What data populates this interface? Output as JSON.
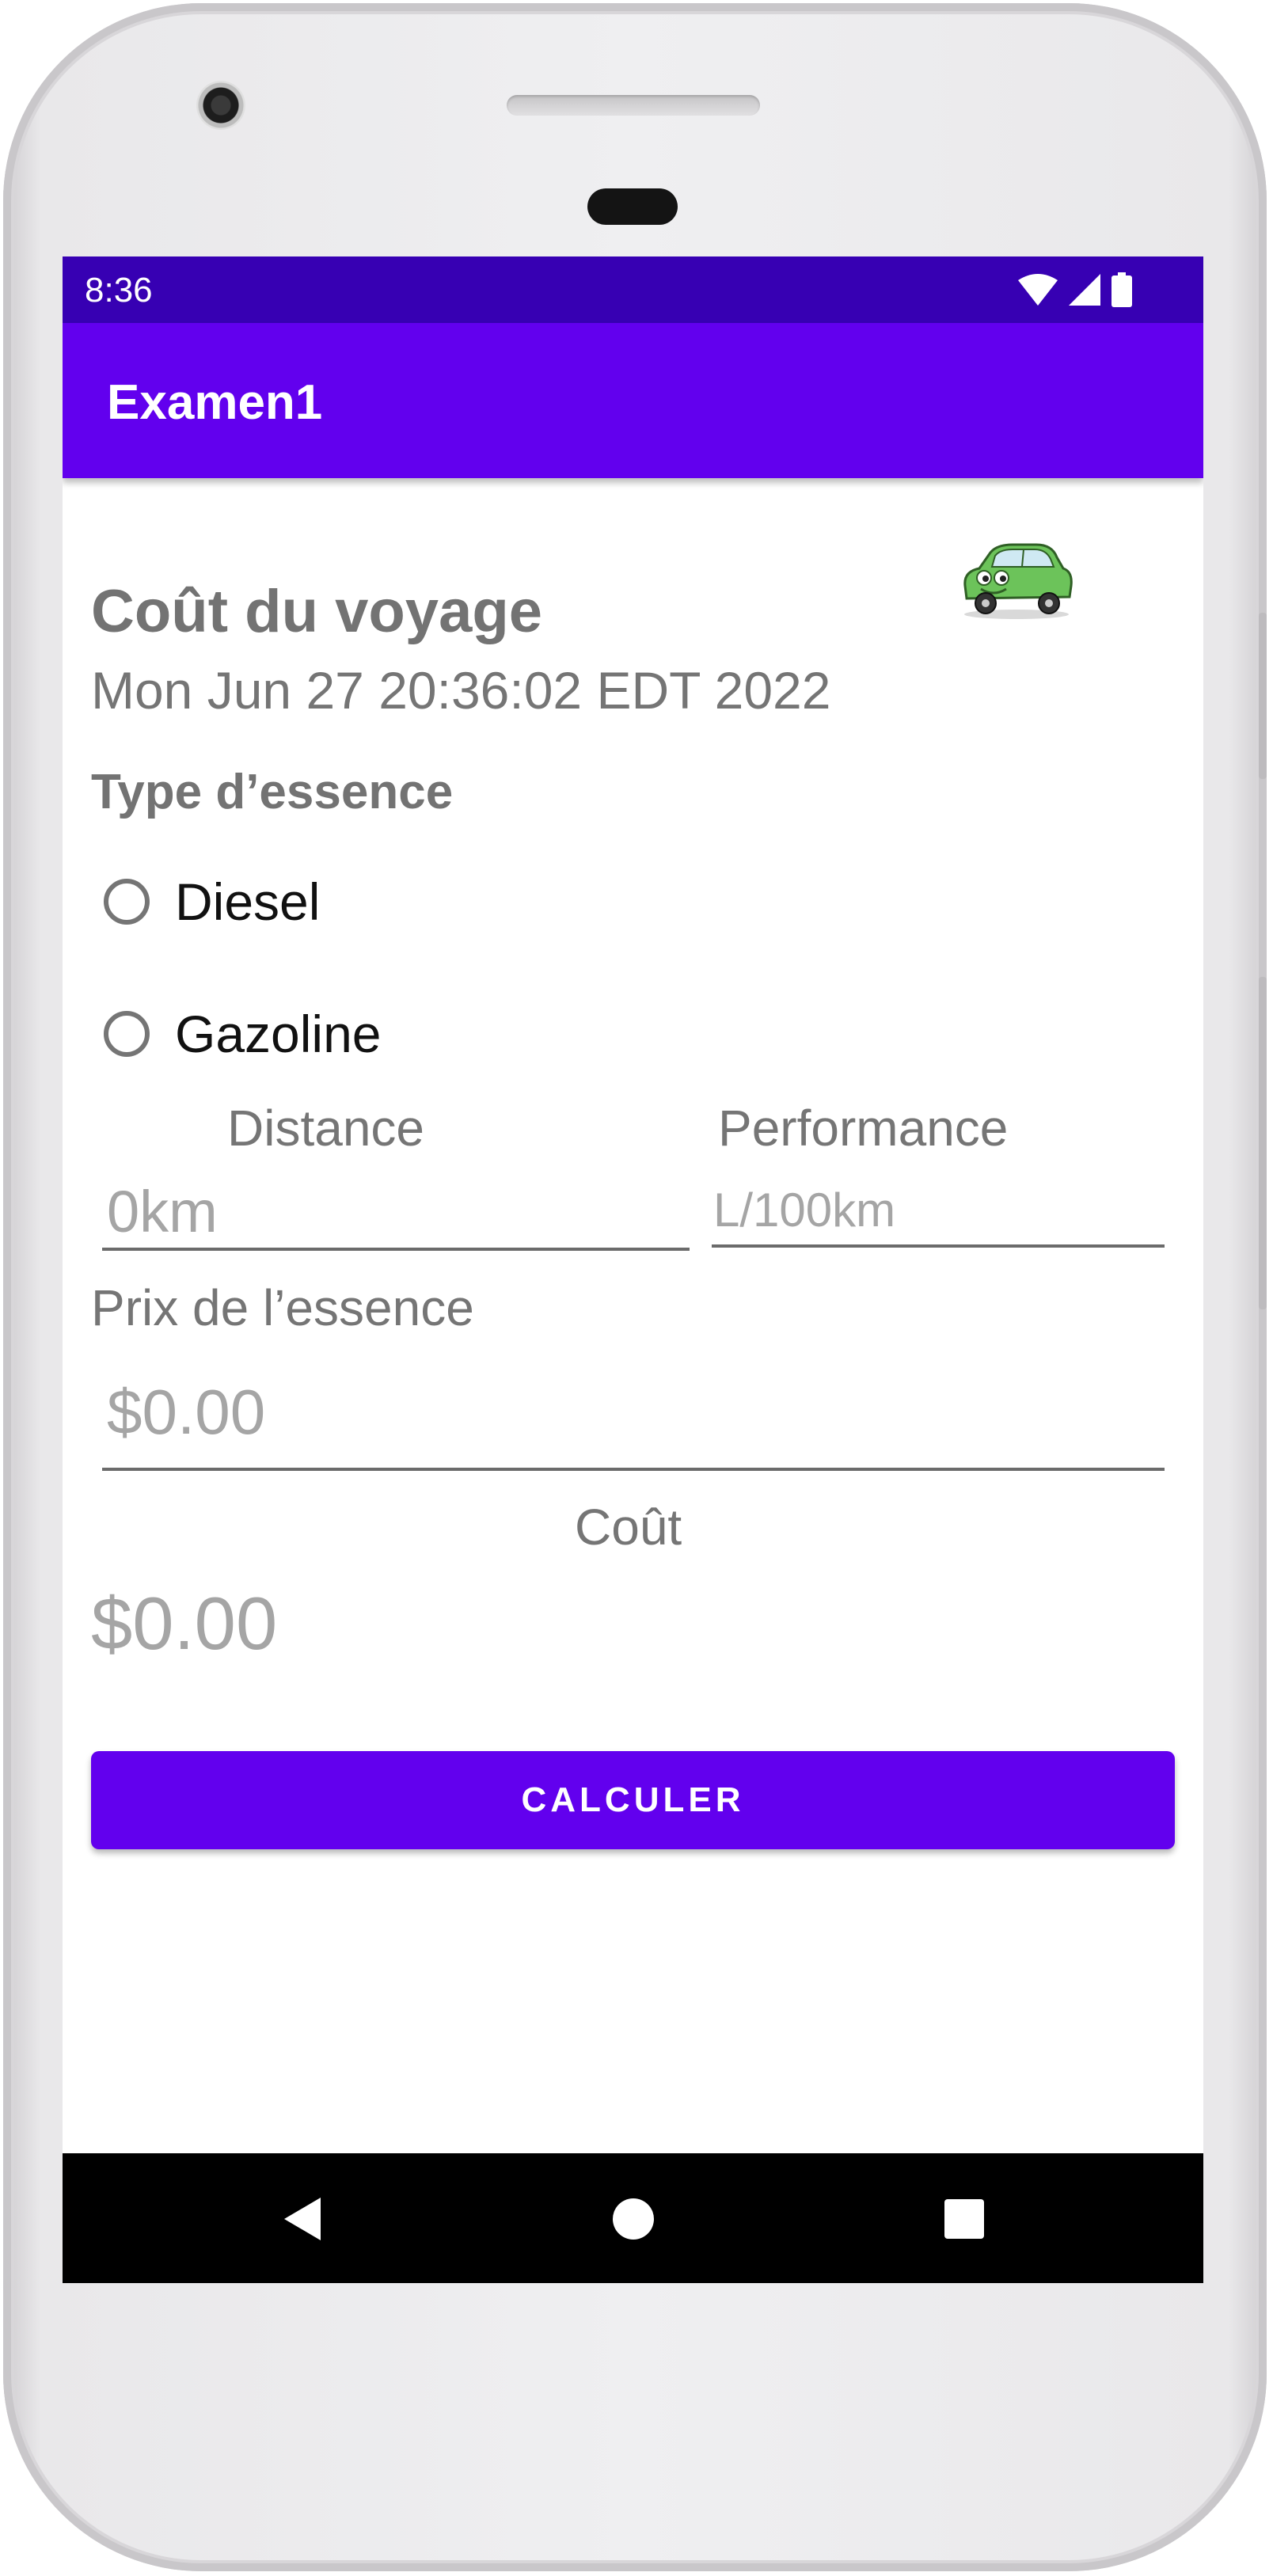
{
  "status_bar": {
    "time": "8:36",
    "icons": [
      "wifi-icon",
      "signal-icon",
      "battery-icon"
    ]
  },
  "app_bar": {
    "title": "Examen1"
  },
  "main": {
    "logo": "car-icon",
    "title": "Coût du voyage",
    "date": "Mon Jun 27 20:36:02 EDT 2022",
    "fuel_type_label": "Type d’essence",
    "fuel_options": [
      {
        "label": "Diesel",
        "selected": false
      },
      {
        "label": "Gazoline",
        "selected": false
      }
    ],
    "distance": {
      "label": "Distance",
      "value": "",
      "placeholder": "0km"
    },
    "performance": {
      "label": "Performance",
      "value": "",
      "placeholder": "L/100km"
    },
    "price": {
      "label": "Prix de l’essence",
      "value": "",
      "placeholder": "$0.00"
    },
    "cost": {
      "label": "Coût",
      "value": "$0.00"
    },
    "calculate_label": "CALCULER"
  },
  "nav_bar": {
    "buttons": [
      "back-icon",
      "home-icon",
      "recents-icon"
    ]
  },
  "colors": {
    "status_bar": "#3700b3",
    "app_bar": "#6200ee",
    "button": "#6200ee",
    "label_text": "#757575",
    "hint_text": "#a5a5a5"
  }
}
